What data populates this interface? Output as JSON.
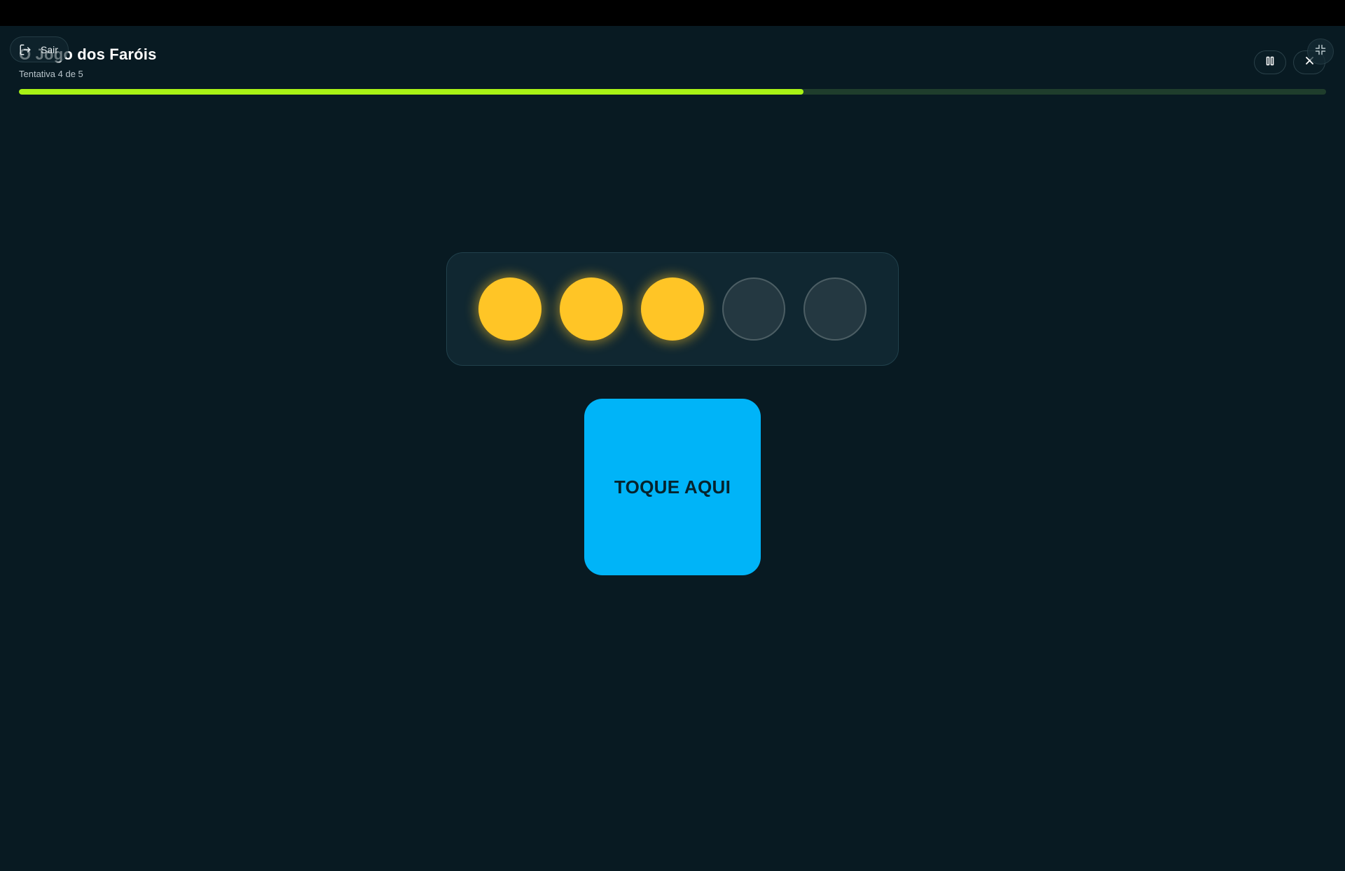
{
  "game": {
    "title": "O Jogo dos Faróis",
    "attempt_text": "Tentativa 4 de 5",
    "progress": 0.6
  },
  "header": {
    "exit_label": "Sair",
    "icons": {
      "exit": "exit-icon",
      "pause": "pause-icon",
      "close": "close-icon",
      "fullscreen": "exit-fullscreen-icon"
    }
  },
  "lights": {
    "total": 5,
    "lit": 3,
    "states": [
      "on",
      "on",
      "on",
      "off",
      "off"
    ]
  },
  "tap_button": {
    "label": "TOQUE AQUI"
  },
  "colors": {
    "background": "#081a22",
    "progress_fill": "#a8f216",
    "progress_track": "#1f3d2c",
    "light_on": "#ffc526",
    "light_off": "#243841",
    "tap_button": "#00b4f8"
  }
}
